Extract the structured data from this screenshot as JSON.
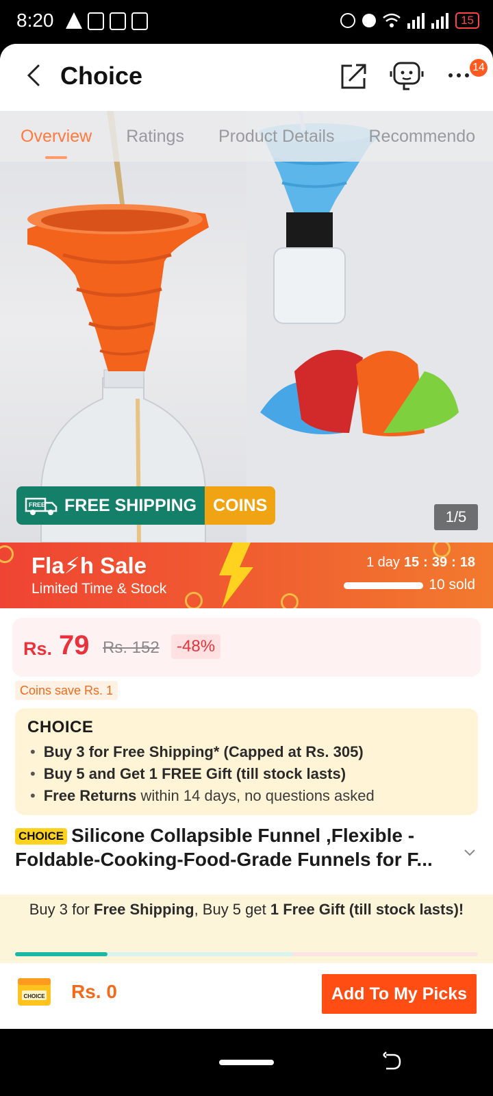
{
  "status_bar": {
    "time": "8:20",
    "battery": "15"
  },
  "header": {
    "title": "Choice",
    "notification_count": "14"
  },
  "tabs": [
    {
      "label": "Overview",
      "active": true
    },
    {
      "label": "Ratings",
      "active": false
    },
    {
      "label": "Product Details",
      "active": false
    },
    {
      "label": "Recommendo",
      "active": false
    }
  ],
  "gallery": {
    "counter": "1/5",
    "shipping_badge": {
      "free_tag": "FREE",
      "label": "FREE SHIPPING",
      "coins": "COINS"
    }
  },
  "flash_sale": {
    "title": "Fla⚡h Sale",
    "subtitle": "Limited Time & Stock",
    "days": "1 day",
    "hours": "15",
    "minutes": "39",
    "seconds": "18",
    "sold": "10 sold",
    "sold_progress": 1.0
  },
  "price": {
    "currency": "Rs.",
    "current": "79",
    "original": "Rs. 152",
    "discount": "-48%",
    "coins_save": "Coins save Rs. 1"
  },
  "choice_benefits": {
    "logo": "CHOICE",
    "items": [
      {
        "bold": "Buy 3 for  Free Shipping* (Capped at Rs. 305)",
        "rest": ""
      },
      {
        "bold": "Buy 5 and Get 1 FREE Gift (till stock lasts)",
        "rest": ""
      },
      {
        "bold": "Free Returns",
        "rest": " within 14 days, no questions asked"
      }
    ]
  },
  "product": {
    "tag": "CHOICE",
    "title": "Silicone Collapsible Funnel ,Flexible -Foldable-Cooking-Food-Grade Funnels for F..."
  },
  "promo": {
    "p1": "Buy 3 for ",
    "b1": "Free Shipping",
    "p2": ", Buy 5 get ",
    "b2": "1 Free Gift (till stock lasts)!",
    "progress": 0.2
  },
  "bottom_bar": {
    "cart_label": "CHOICE",
    "total": "Rs. 0",
    "add_button": "Add To My Picks"
  },
  "colors": {
    "accent_orange": "#ff4d14",
    "price_red": "#e8333c",
    "shipping_green": "#14806a",
    "coins_yellow": "#f0a414",
    "choice_yellow": "#ffd21f"
  }
}
